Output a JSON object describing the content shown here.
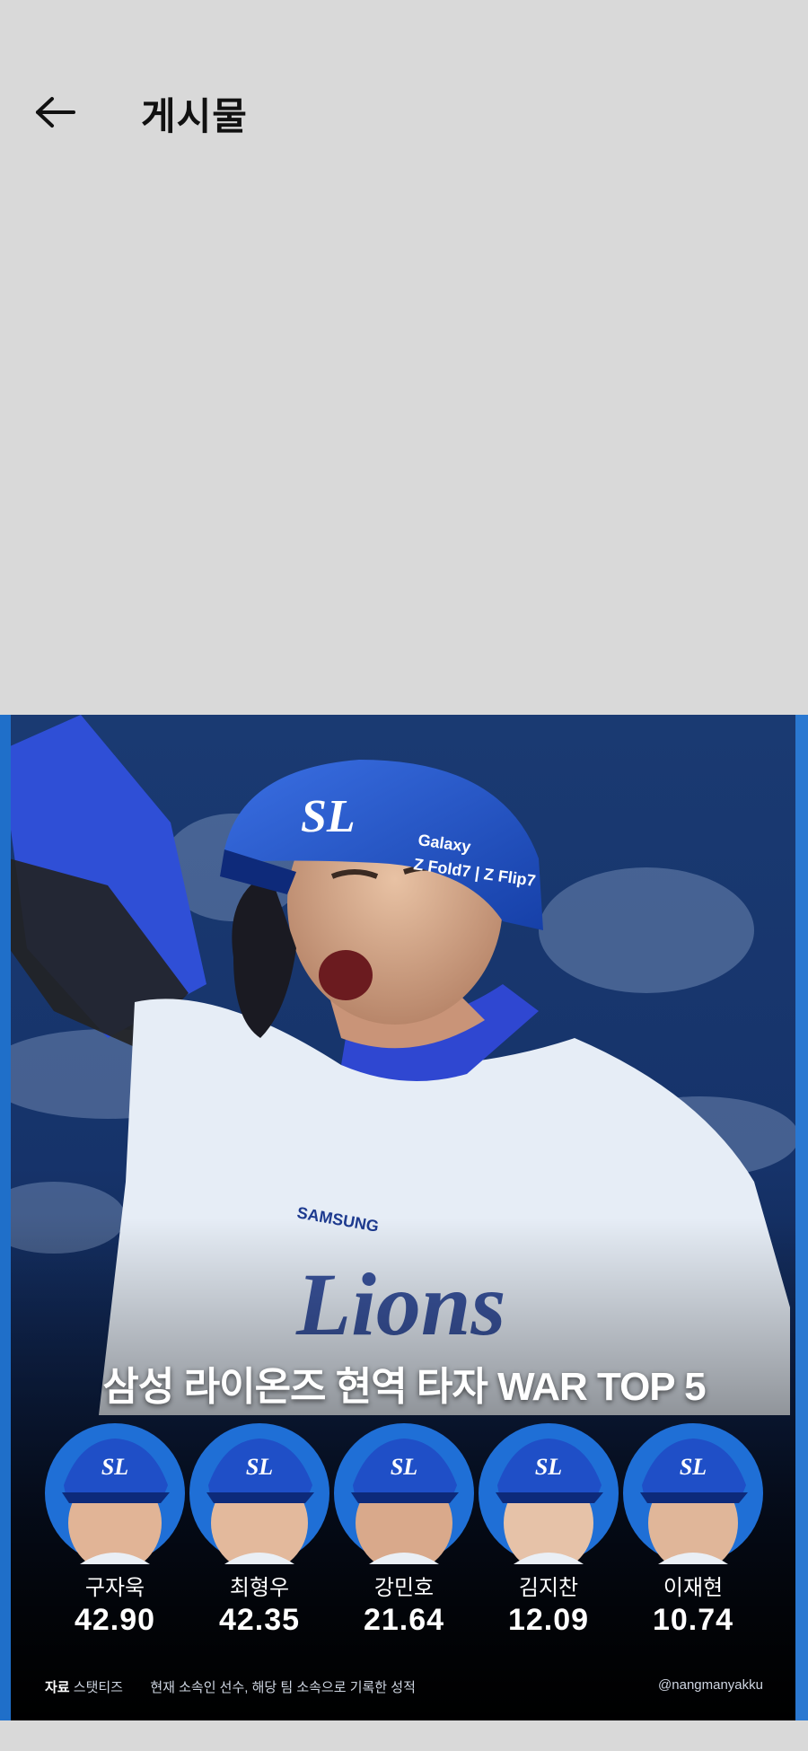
{
  "header": {
    "back_icon": "arrow-left-icon",
    "title": "게시물"
  },
  "post": {
    "headline": "삼성 라이온즈 현역 타자 WAR TOP 5",
    "helmet_text": "Galaxy Z Fold7 | Z Flip7",
    "jersey_text": "Lions",
    "sponsor_text": "SAMSUNG",
    "players": [
      {
        "name": "구자욱",
        "war": "42.90"
      },
      {
        "name": "최형우",
        "war": "42.35"
      },
      {
        "name": "강민호",
        "war": "21.64"
      },
      {
        "name": "김지찬",
        "war": "12.09"
      },
      {
        "name": "이재현",
        "war": "10.74"
      }
    ],
    "footer": {
      "source_label": "자료",
      "source_name": "스탯티즈",
      "note": "현재 소속인 선수, 해당 팀 소속으로 기록한 성적",
      "handle": "@nangmanyakku"
    }
  },
  "colors": {
    "background": "#d9d9d9",
    "team_blue": "#1f5fd0",
    "accent_blue": "#2a78d1"
  }
}
